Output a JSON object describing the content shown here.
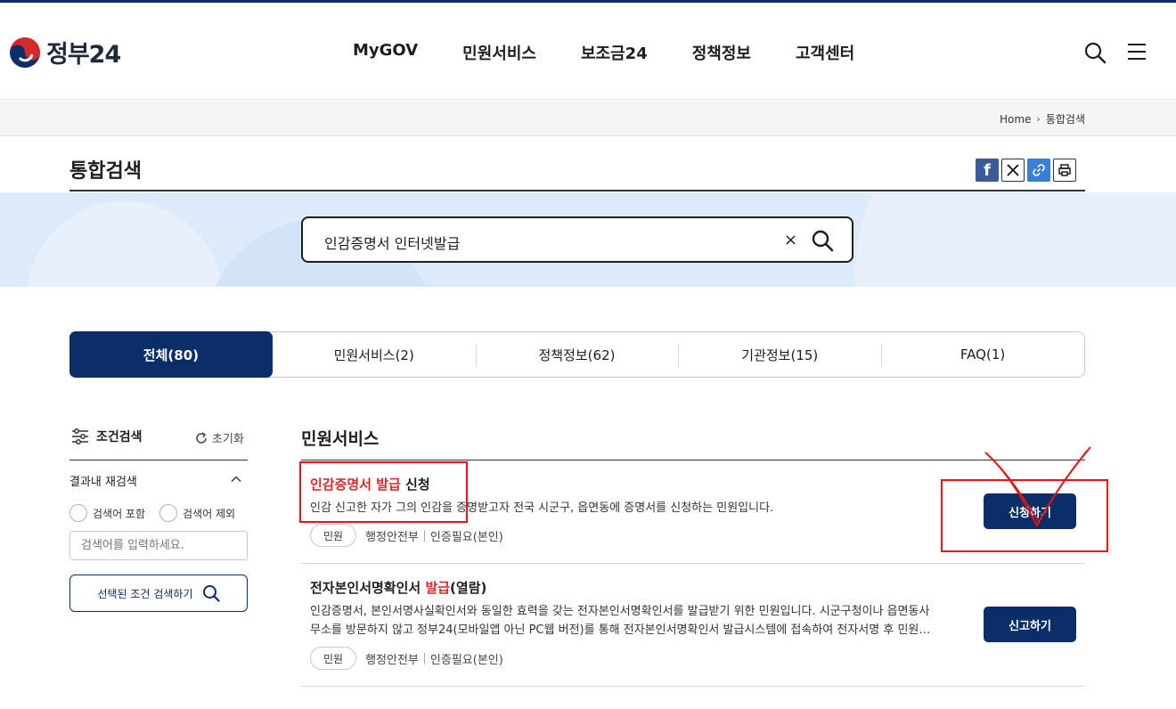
{
  "header": {
    "logo_text": "정부24",
    "nav": [
      {
        "label": "MyGOV"
      },
      {
        "label": "민원서비스"
      },
      {
        "label": "보조금24"
      },
      {
        "label": "정책정보"
      },
      {
        "label": "고객센터"
      }
    ],
    "icons": {
      "search": "search-icon",
      "menu": "hamburger-icon"
    },
    "brand_color": "#0b2d68"
  },
  "breadcrumb": {
    "home": "Home",
    "current": "통합검색"
  },
  "page": {
    "title": "통합검색",
    "share_icons": [
      "facebook-icon",
      "x-icon",
      "link-icon",
      "print-icon"
    ]
  },
  "search": {
    "query": "인감증명서 인터넷발급",
    "clear_symbol": "×"
  },
  "tabs": [
    {
      "label": "전체(80)",
      "active": true
    },
    {
      "label": "민원서비스(2)"
    },
    {
      "label": "정책정보(62)"
    },
    {
      "label": "기관정보(15)"
    },
    {
      "label": "FAQ(1)"
    }
  ],
  "sidebar": {
    "title": "조건검색",
    "reset": "초기화",
    "subtitle": "결과내 재검색",
    "include_label": "검색어 포함",
    "exclude_label": "검색어 제외",
    "input_placeholder": "검색어를 입력하세요.",
    "search_button": "선택된 조건 검색하기"
  },
  "results_section": {
    "title": "민원서비스",
    "items": [
      {
        "title_hl": "인감증명서 발급",
        "title_rest": " 신청",
        "desc": [
          "인감 신고한 자가 그의 인감을 증명받고자 전국 시군구, 읍면동에 증명서를 신청하는 민원입니다."
        ],
        "chip": "민원",
        "org": "행정안전부",
        "auth": "인증필요(본인)",
        "button": "신청하기"
      },
      {
        "title_pre": "전자본인서명확인서 ",
        "title_hl": "발급",
        "title_rest": "(열람)",
        "desc": [
          "인감증명서, 본인서명사실확인서와 동일한 효력을 갖는 전자본인서명확인서를 발급받기 위한 민원입니다. 시군구청이나 읍면동사",
          "무소를 방문하지 않고 정부24(모바일앱 아닌 PC웹 버전)를 통해 전자본인서명확인서 발급시스템에 접속하여 전자서명 후 민원…"
        ],
        "chip": "민원",
        "org": "행정안전부",
        "auth": "인증필요(본인)",
        "button": "신고하기"
      }
    ]
  },
  "annotation_color": "#e61414"
}
